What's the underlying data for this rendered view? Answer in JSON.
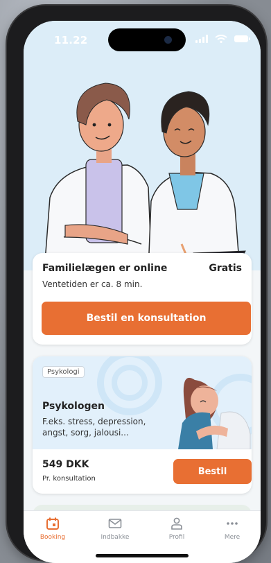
{
  "status_bar": {
    "time": "11.22"
  },
  "online_card": {
    "title": "Familielægen er online",
    "price": "Gratis",
    "wait": "Ventetiden er ca. 8 min.",
    "button": "Bestil en konsultation"
  },
  "psychology_card": {
    "tag": "Psykologi",
    "title": "Psykologen",
    "description": "F.eks. stress, depression, angst, sorg, jalousi...",
    "price": "549 DKK",
    "price_unit": "Pr. konsultation",
    "button": "Bestil"
  },
  "tabbar": {
    "items": [
      {
        "label": "Booking",
        "icon": "calendar-icon",
        "active": true
      },
      {
        "label": "Indbakke",
        "icon": "envelope-icon",
        "active": false
      },
      {
        "label": "Profil",
        "icon": "person-icon",
        "active": false
      },
      {
        "label": "Mere",
        "icon": "more-dots-icon",
        "active": false
      }
    ]
  },
  "colors": {
    "accent": "#e86f33",
    "hero_bg": "#dcedf8",
    "card_bg": "#ffffff",
    "tab_inactive": "#8a8f96"
  }
}
